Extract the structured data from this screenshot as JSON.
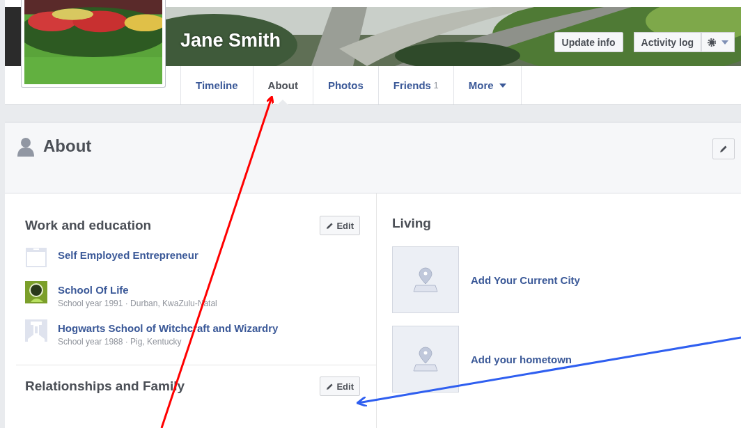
{
  "profile": {
    "name": "Jane Smith",
    "actions": [
      "Update info",
      "Activity log"
    ]
  },
  "tabs": [
    {
      "label": "Timeline",
      "selected": false
    },
    {
      "label": "About",
      "selected": true
    },
    {
      "label": "Photos",
      "selected": false
    },
    {
      "label": "Friends",
      "count": "1",
      "selected": false
    },
    {
      "label": "More",
      "dropdown": true,
      "selected": false
    }
  ],
  "about": {
    "title": "About"
  },
  "work_education": {
    "title": "Work and education",
    "edit": "Edit",
    "items": [
      {
        "kind": "work",
        "title": "Self Employed Entrepreneur"
      },
      {
        "kind": "logo",
        "title": "School Of Life",
        "detail": "School year 1991 · Durban, KwaZulu-Natal"
      },
      {
        "kind": "school",
        "title": "Hogwarts School of Witchcraft and Wizardry",
        "detail": "School year 1988 · Pig, Kentucky"
      }
    ]
  },
  "relationships": {
    "title": "Relationships and Family",
    "edit": "Edit"
  },
  "living": {
    "title": "Living",
    "items": [
      {
        "label": "Add Your Current City"
      },
      {
        "label": "Add your hometown"
      }
    ]
  }
}
